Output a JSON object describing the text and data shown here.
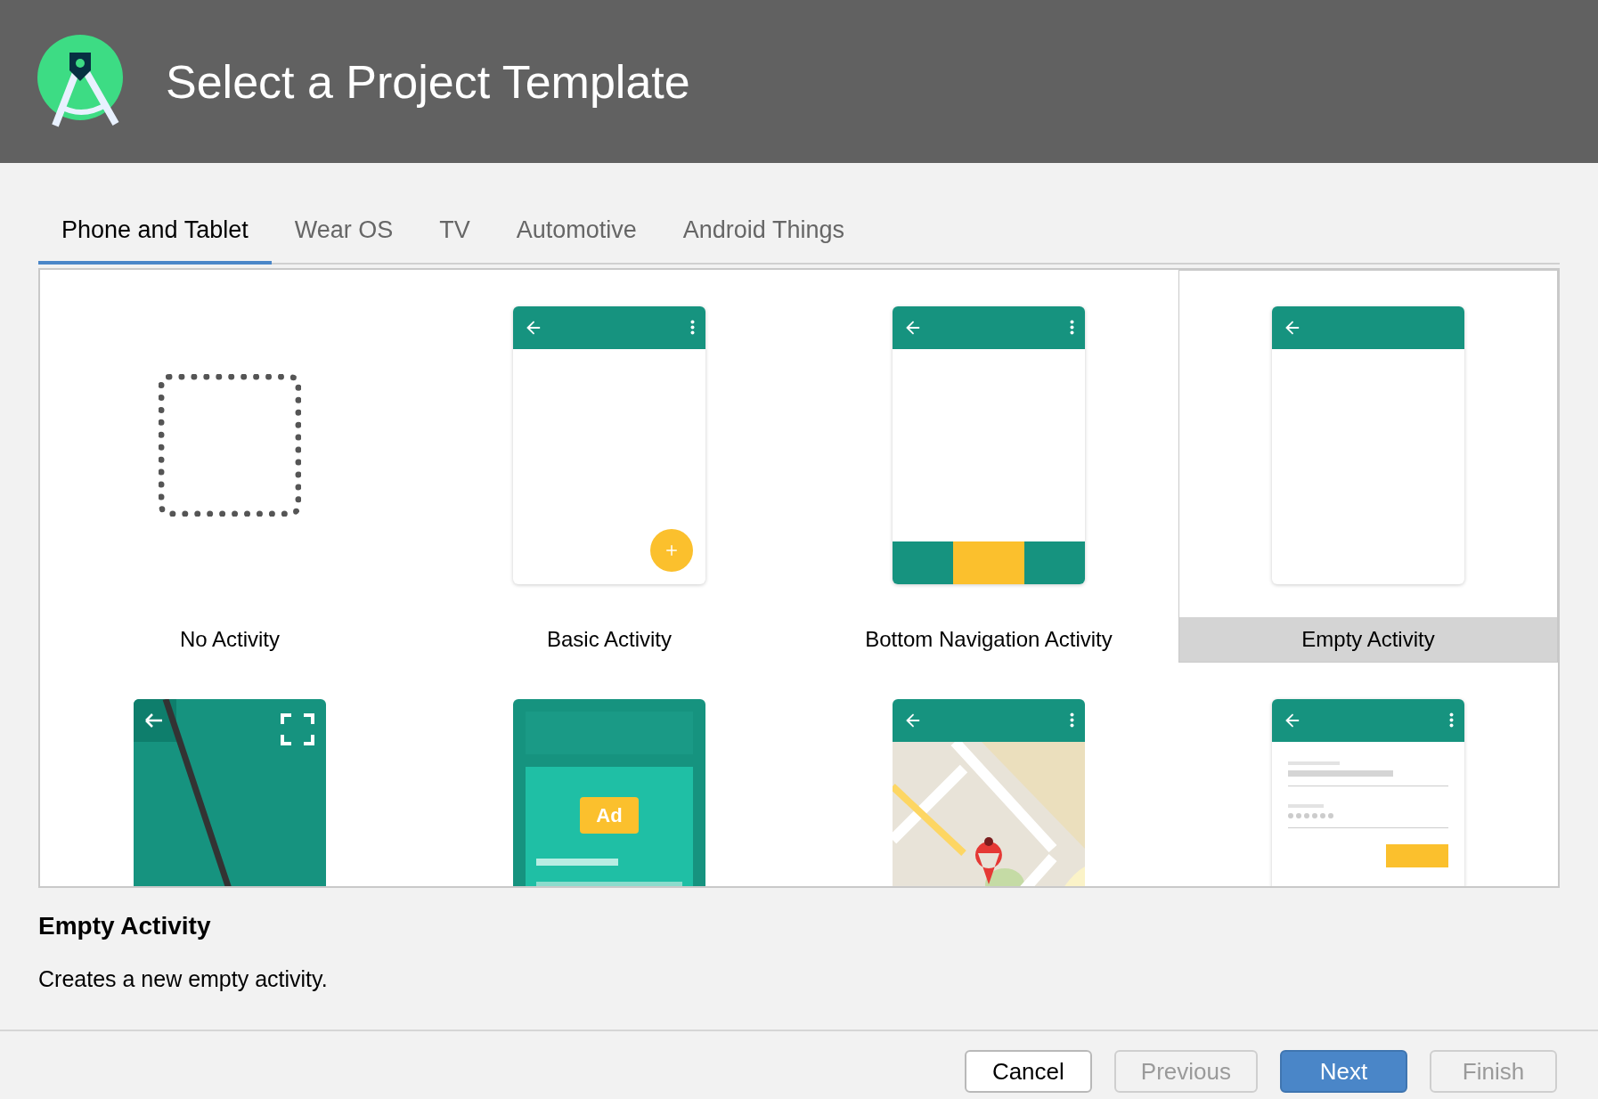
{
  "header": {
    "title": "Select a Project Template"
  },
  "tabs": [
    {
      "label": "Phone and Tablet",
      "selected": true
    },
    {
      "label": "Wear OS",
      "selected": false
    },
    {
      "label": "TV",
      "selected": false
    },
    {
      "label": "Automotive",
      "selected": false
    },
    {
      "label": "Android Things",
      "selected": false
    }
  ],
  "templates": [
    {
      "kind": "none",
      "name": "No Activity",
      "selected": false
    },
    {
      "kind": "basic",
      "name": "Basic Activity",
      "selected": false
    },
    {
      "kind": "bottomnav",
      "name": "Bottom Navigation Activity",
      "selected": false
    },
    {
      "kind": "empty",
      "name": "Empty Activity",
      "selected": true
    },
    {
      "kind": "fullscreen",
      "selected": false
    },
    {
      "kind": "ads",
      "ad_label": "Ad",
      "selected": false
    },
    {
      "kind": "map",
      "selected": false
    },
    {
      "kind": "login",
      "selected": false
    }
  ],
  "description": {
    "title": "Empty Activity",
    "text": "Creates a new empty activity."
  },
  "buttons": [
    {
      "label": "Cancel",
      "kind": "default",
      "disabled": false
    },
    {
      "label": "Previous",
      "kind": "default",
      "disabled": true
    },
    {
      "label": "Next",
      "kind": "primary",
      "disabled": false
    },
    {
      "label": "Finish",
      "kind": "default",
      "disabled": true
    }
  ]
}
